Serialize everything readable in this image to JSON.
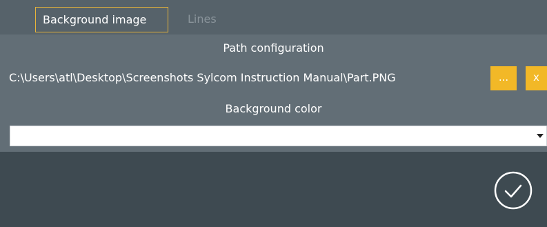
{
  "tabs": {
    "background_image": "Background image",
    "lines": "Lines"
  },
  "path_section": {
    "title": "Path configuration",
    "path_value": "C:\\Users\\atl\\Desktop\\Screenshots Sylcom Instruction Manual\\Part.PNG",
    "browse_label": "...",
    "clear_label": "x"
  },
  "color_section": {
    "title": "Background color",
    "selected_value": ""
  },
  "icons": {
    "dropdown": "chevron-down-icon",
    "confirm": "check-circle-icon"
  },
  "colors": {
    "accent": "#f2b827",
    "tab_border": "#e7b43a",
    "panel": "#626e76",
    "tabbar": "#56626a",
    "background": "#3e4a51"
  }
}
